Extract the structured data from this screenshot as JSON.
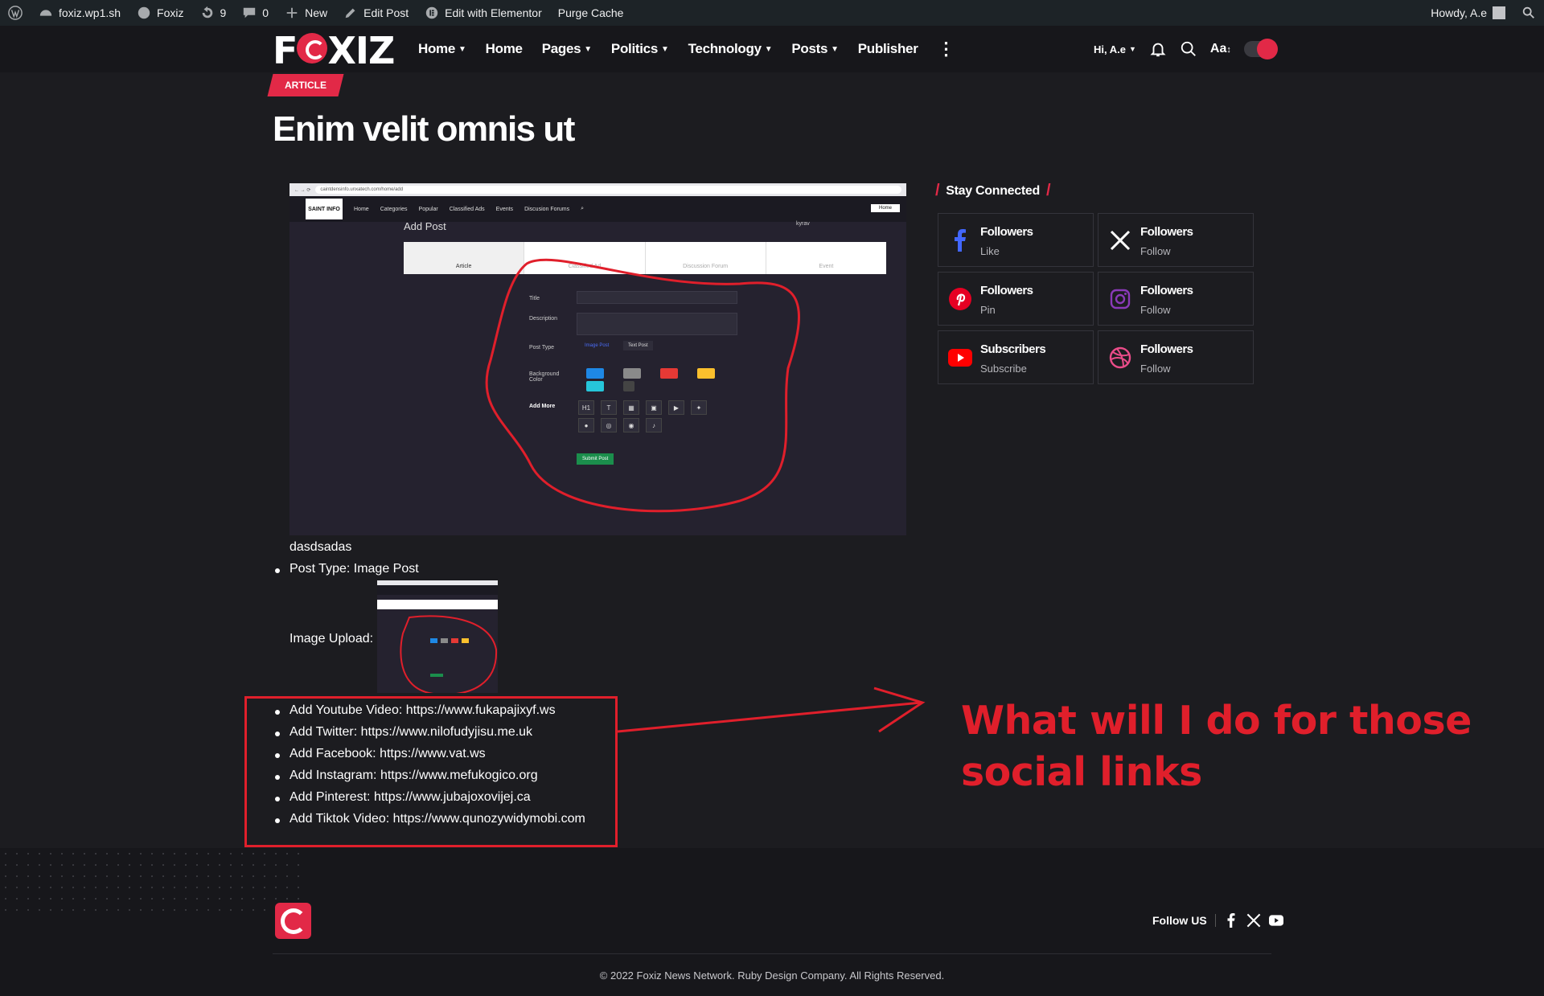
{
  "adminbar": {
    "site": "foxiz.wp1.sh",
    "theme": "Foxiz",
    "updates": "9",
    "comments": "0",
    "new": "New",
    "edit_post": "Edit Post",
    "edit_elementor": "Edit with Elementor",
    "purge_cache": "Purge Cache",
    "howdy": "Howdy, A.e"
  },
  "header": {
    "logo": "FOXIZ",
    "nav": [
      {
        "label": "Home",
        "has_dropdown": true
      },
      {
        "label": "Home",
        "has_dropdown": false
      },
      {
        "label": "Pages",
        "has_dropdown": true
      },
      {
        "label": "Politics",
        "has_dropdown": true
      },
      {
        "label": "Technology",
        "has_dropdown": true
      },
      {
        "label": "Posts",
        "has_dropdown": true
      },
      {
        "label": "Publisher",
        "has_dropdown": false
      }
    ],
    "greeting": "Hi, A.e",
    "font_resize": "Aa"
  },
  "article": {
    "category": "ARTICLE",
    "title": "Enim velit omnis ut",
    "description": "dasdsadas",
    "post_type": "Post Type: Image Post",
    "image_upload_label": "Image Upload:",
    "links": [
      "Add Youtube Video: https://www.fukapajixyf.ws",
      "Add Twitter: https://www.nilofudyjisu.me.uk",
      "Add Facebook: https://www.vat.ws",
      "Add Instagram: https://www.mefukogico.org",
      "Add Pinterest: https://www.jubajoxovijej.ca",
      "Add Tiktok Video: https://www.qunozywidymobi.com"
    ]
  },
  "embedded_screenshot": {
    "url": "caintdensinfo.unxatech.com/home/add",
    "logo": "SAINT INFO",
    "nav": [
      "Home",
      "Categories",
      "Popular",
      "Classified Ads",
      "Events",
      "Discusion Forums"
    ],
    "home_button": "Home",
    "heading": "Add Post",
    "user": "kyrav",
    "tabs": [
      "Article",
      "Classified Ad",
      "Discussion Forum",
      "Event"
    ],
    "labels": {
      "title": "Title",
      "description": "Description",
      "post_type": "Post Type",
      "background_color": "Background Color",
      "add_more": "Add More"
    },
    "post_type_options": [
      "Image Post",
      "Text Post"
    ],
    "add_more_icons": [
      "H1",
      "T"
    ],
    "submit": "Submit Post"
  },
  "annotation": "What will I do for those social links",
  "sidebar": {
    "title": "Stay Connected",
    "cards": [
      {
        "icon": "facebook-icon",
        "name": "Followers",
        "action": "Like",
        "color": "#4267ff"
      },
      {
        "icon": "x-twitter-icon",
        "name": "Followers",
        "action": "Follow",
        "color": "#ffffff"
      },
      {
        "icon": "pinterest-icon",
        "name": "Followers",
        "action": "Pin",
        "color": "#e60023"
      },
      {
        "icon": "instagram-icon",
        "name": "Followers",
        "action": "Follow",
        "color": "#8a3ab9"
      },
      {
        "icon": "youtube-icon",
        "name": "Subscribers",
        "action": "Subscribe",
        "color": "#ff0000"
      },
      {
        "icon": "dribbble-icon",
        "name": "Followers",
        "action": "Follow",
        "color": "#ea4c89"
      }
    ]
  },
  "footer": {
    "follow_us": "Follow US",
    "copyright": "© 2022 Foxiz News Network. Ruby Design Company. All Rights Reserved."
  },
  "colors": {
    "accent": "#e22947",
    "annotation_red": "#e01f2b",
    "background": "#1c1c20"
  }
}
